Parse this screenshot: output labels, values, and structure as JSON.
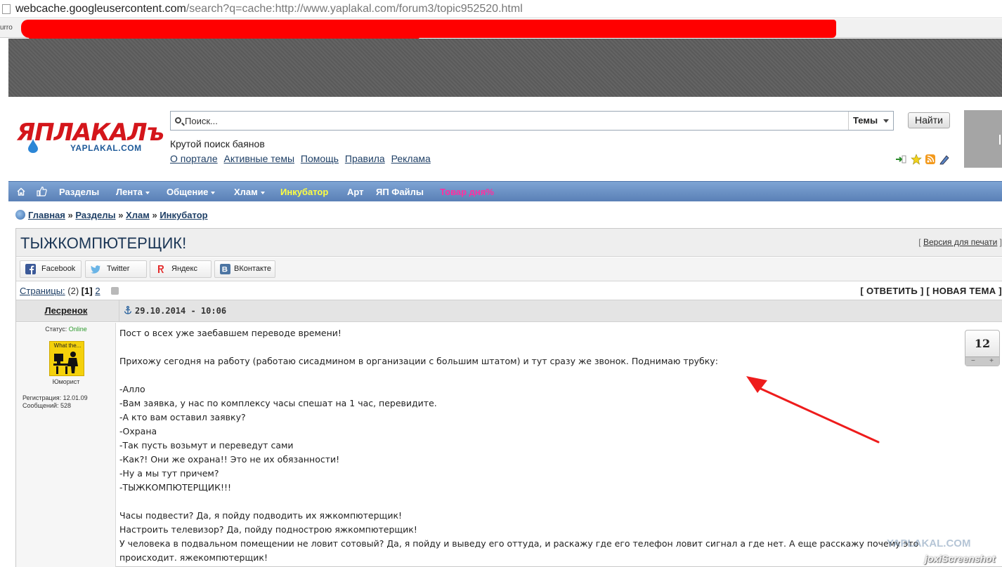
{
  "browser": {
    "url_host": "webcache.googleusercontent.com",
    "url_path": "/search?q=cache:http://www.yaplakal.com/forum3/topic952520.html",
    "bookmark_fragment": "urro"
  },
  "header": {
    "logo_main": "ЯПЛАКАЛъ",
    "logo_sub": "YAPLAKAL.COM",
    "search_placeholder": "Поиск...",
    "search_scope": "Темы",
    "find_label": "Найти",
    "tagline": "Крутой поиск баянов",
    "links": [
      "О портале",
      "Активные темы",
      "Помощь",
      "Правила",
      "Реклама"
    ]
  },
  "nav": {
    "items": [
      {
        "label": "Разделы"
      },
      {
        "label": "Лента"
      },
      {
        "label": "Общение"
      },
      {
        "label": "Хлам"
      },
      {
        "label": "Инкубатор"
      },
      {
        "label": "Арт"
      },
      {
        "label": "ЯП Файлы"
      },
      {
        "label": "Товар дня%"
      }
    ]
  },
  "breadcrumbs": [
    "Главная",
    "Разделы",
    "Хлам",
    "Инкубатор"
  ],
  "breadcrumb_sep": "»",
  "topic": {
    "title": "ТЫЖКОМПЮТЕРЩИК!",
    "print_label": "Версия для печати",
    "share": [
      "Facebook",
      "Twitter",
      "Яндекс",
      "ВКонтакте"
    ],
    "pages_label": "Страницы:",
    "pages_count": "(2)",
    "page_current": "1",
    "page_other": "2",
    "reply_label": "ОТВЕТИТЬ",
    "new_topic_label": "НОВАЯ ТЕМА"
  },
  "post": {
    "author": "Лесренок",
    "date": "29.10.2014 - 10:06",
    "status_label": "Статус:",
    "status_value": "Online",
    "avatar_text": "What the...",
    "rank": "Юморист",
    "reg_label": "Регистрация:",
    "reg_value": "12.01.09",
    "msgs_label": "Сообщений:",
    "msgs_value": "528",
    "rating": "12",
    "rating_minus": "−",
    "rating_plus": "+",
    "lines": [
      "Пост о всех уже заебавшем переводе времени!",
      "",
      "Прихожу сегодня на работу (работаю сисадмином в организации с большим штатом) и тут сразу же звонок. Поднимаю трубку:",
      "",
      "-Алло",
      "-Вам заявка, у нас по комплексу часы спешат на 1 час, перевидите.",
      "-А кто вам оставил заявку?",
      "-Охрана",
      "-Так пусть возьмут и переведут сами",
      "-Как?! Они же охрана!! Это не их обязанности!",
      "-Ну а мы тут причем?",
      "-ТЫЖКОМПЮТЕРЩИК!!!",
      "",
      "Часы подвести? Да, я пойду подводить их яжкомпютерщик!",
      "Настроить телевизор? Да, пойду подностро­ю яжкомпютерщик!",
      "У человека в подвальном помещении не ловит сотовый? Да, я пойду и выведу его оттуда, и раскажу где его телефон ловит сигнал а где нет. А еще расскажу почему это",
      "происходит. яжекомпютерщик!"
    ]
  },
  "watermark": {
    "site": "YAPLAKAL.COM",
    "tool": "joxiScreenshot"
  },
  "colors": {
    "nav_blue": "#6a90c6",
    "logo_red": "#d4161b",
    "link_blue": "#1e3f66",
    "redaction": "#ff0000",
    "arrow": "#ee1c1c"
  }
}
